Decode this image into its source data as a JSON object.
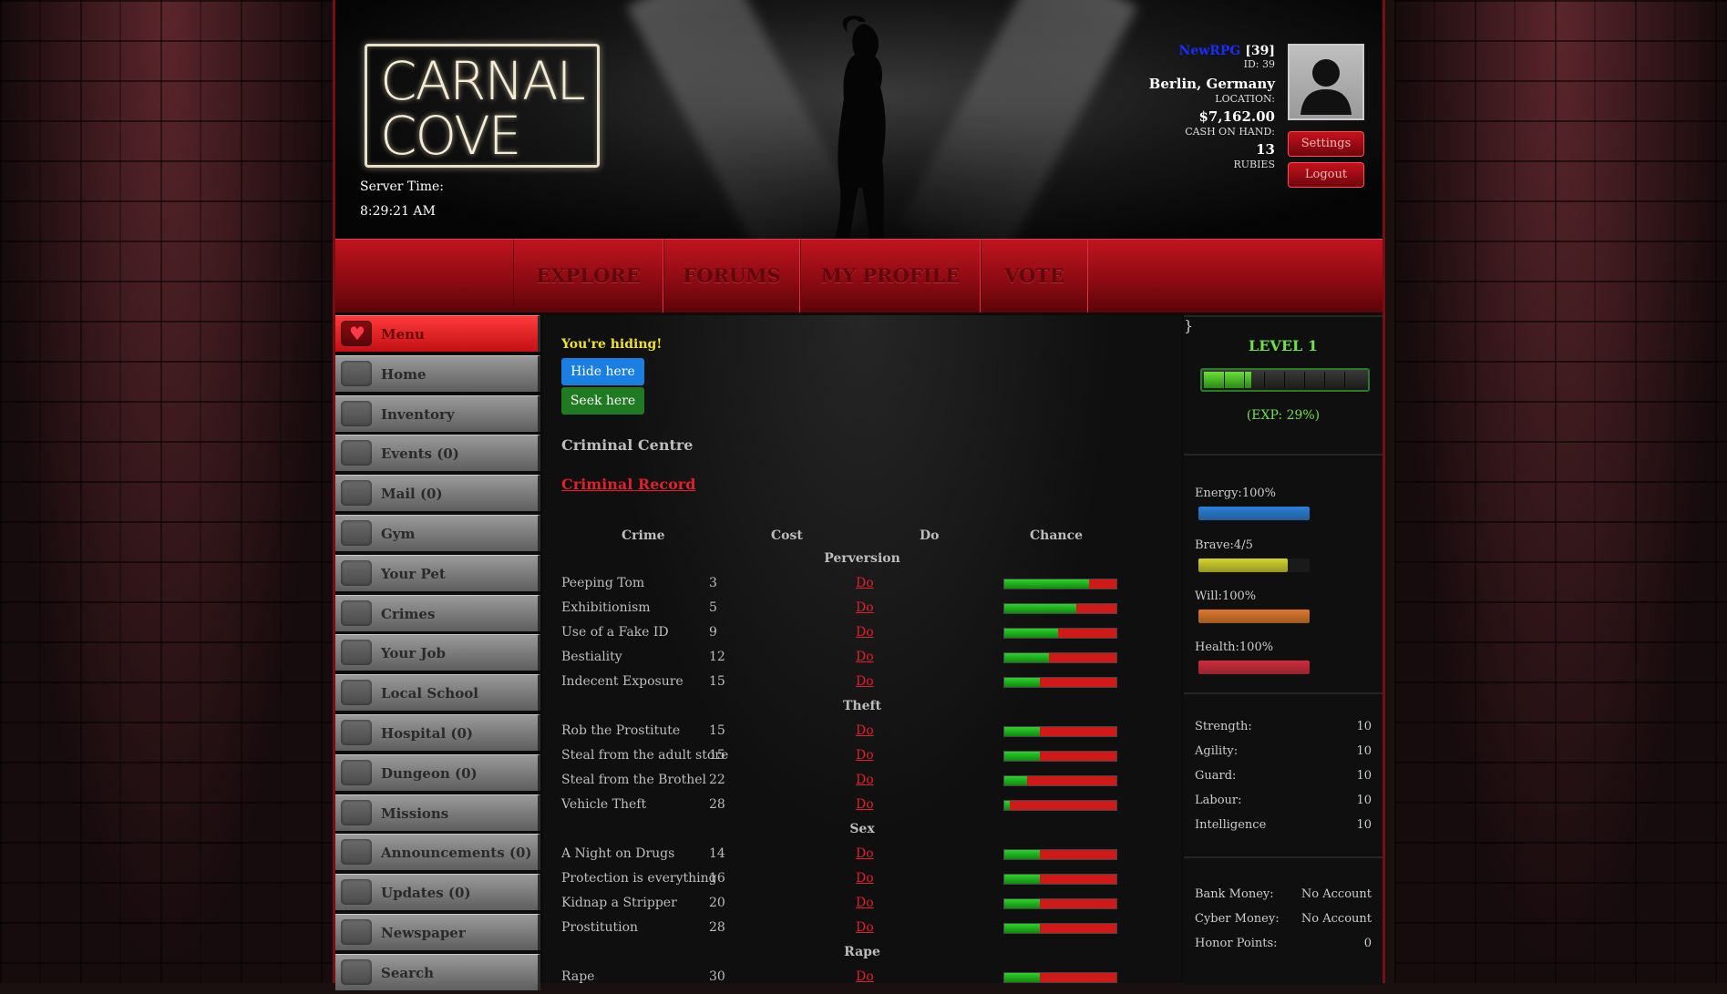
{
  "header": {
    "logo_line1": "CARNAL",
    "logo_line2": "COVE",
    "server_time_label": "Server Time:",
    "server_time": "8:29:21 AM",
    "user_name": "NewRPG",
    "user_level_tag": "[39]",
    "user_id": "ID: 39",
    "location_value": "Berlin, Germany",
    "location_label": "LOCATION:",
    "cash_value": "$7,162.00",
    "cash_label": "CASH ON HAND:",
    "rubies_value": "13",
    "rubies_label": "RUBIES",
    "settings_button": "Settings",
    "logout_button": "Logout"
  },
  "nav": [
    "EXPLORE",
    "FORUMS",
    "MY PROFILE",
    "VOTE"
  ],
  "sidebar": [
    "Menu",
    "Home",
    "Inventory",
    "Events (0)",
    "Mail (0)",
    "Gym",
    "Your Pet",
    "Crimes",
    "Your Job",
    "Local School",
    "Hospital (0)",
    "Dungeon (0)",
    "Missions",
    "Announcements (0)",
    "Updates (0)",
    "Newspaper",
    "Search"
  ],
  "main": {
    "hiding_text": "You're hiding!",
    "hide_button": "Hide here",
    "seek_button": "Seek here",
    "title": "Criminal Centre",
    "record_link": "Criminal Record",
    "columns": [
      "Crime",
      "Cost",
      "Do",
      "Chance"
    ],
    "categories": [
      {
        "name": "Perversion",
        "crimes": [
          {
            "name": "Peeping Tom",
            "cost": "3",
            "do": "Do",
            "chance": 0.76
          },
          {
            "name": "Exhibitionism",
            "cost": "5",
            "do": "Do",
            "chance": 0.64
          },
          {
            "name": "Use of a Fake ID",
            "cost": "9",
            "do": "Do",
            "chance": 0.48
          },
          {
            "name": "Bestiality",
            "cost": "12",
            "do": "Do",
            "chance": 0.4
          },
          {
            "name": "Indecent Exposure",
            "cost": "15",
            "do": "Do",
            "chance": 0.32
          }
        ]
      },
      {
        "name": "Theft",
        "crimes": [
          {
            "name": "Rob the Prostitute",
            "cost": "15",
            "do": "Do",
            "chance": 0.32
          },
          {
            "name": "Steal from the adult store",
            "cost": "15",
            "do": "Do",
            "chance": 0.32
          },
          {
            "name": "Steal from the Brothel",
            "cost": "22",
            "do": "Do",
            "chance": 0.2
          },
          {
            "name": "Vehicle Theft",
            "cost": "28",
            "do": "Do",
            "chance": 0.05
          }
        ]
      },
      {
        "name": "Sex",
        "crimes": [
          {
            "name": "A Night on Drugs",
            "cost": "14",
            "do": "Do",
            "chance": 0.32
          },
          {
            "name": "Protection is everything",
            "cost": "16",
            "do": "Do",
            "chance": 0.32
          },
          {
            "name": "Kidnap a Stripper",
            "cost": "20",
            "do": "Do",
            "chance": 0.32
          },
          {
            "name": "Prostitution",
            "cost": "28",
            "do": "Do",
            "chance": 0.32
          }
        ]
      },
      {
        "name": "Rape",
        "crimes": [
          {
            "name": "Rape",
            "cost": "30",
            "do": "Do",
            "chance": 0.32
          }
        ]
      }
    ]
  },
  "right": {
    "level": "LEVEL 1",
    "exp_fraction": 0.29,
    "exp_text": "(EXP: 29%)",
    "bars": [
      {
        "label": "Energy:100%",
        "fraction": 1.0,
        "color": "#2a7fd8"
      },
      {
        "label": "Brave:4/5",
        "fraction": 0.8,
        "color": "#d4d42a"
      },
      {
        "label": "Will:100%",
        "fraction": 1.0,
        "color": "#e0782a"
      },
      {
        "label": "Health:100%",
        "fraction": 1.0,
        "color": "#d02a3a"
      }
    ],
    "stats": [
      {
        "label": "Strength:",
        "value": "10"
      },
      {
        "label": "Agility:",
        "value": "10"
      },
      {
        "label": "Guard:",
        "value": "10"
      },
      {
        "label": "Labour:",
        "value": "10"
      },
      {
        "label": "Intelligence",
        "value": "10"
      }
    ],
    "accounts": [
      {
        "label": "Bank Money:",
        "value": "No Account"
      },
      {
        "label": "Cyber Money:",
        "value": "No Account"
      },
      {
        "label": "Honor Points:",
        "value": "0"
      }
    ]
  }
}
